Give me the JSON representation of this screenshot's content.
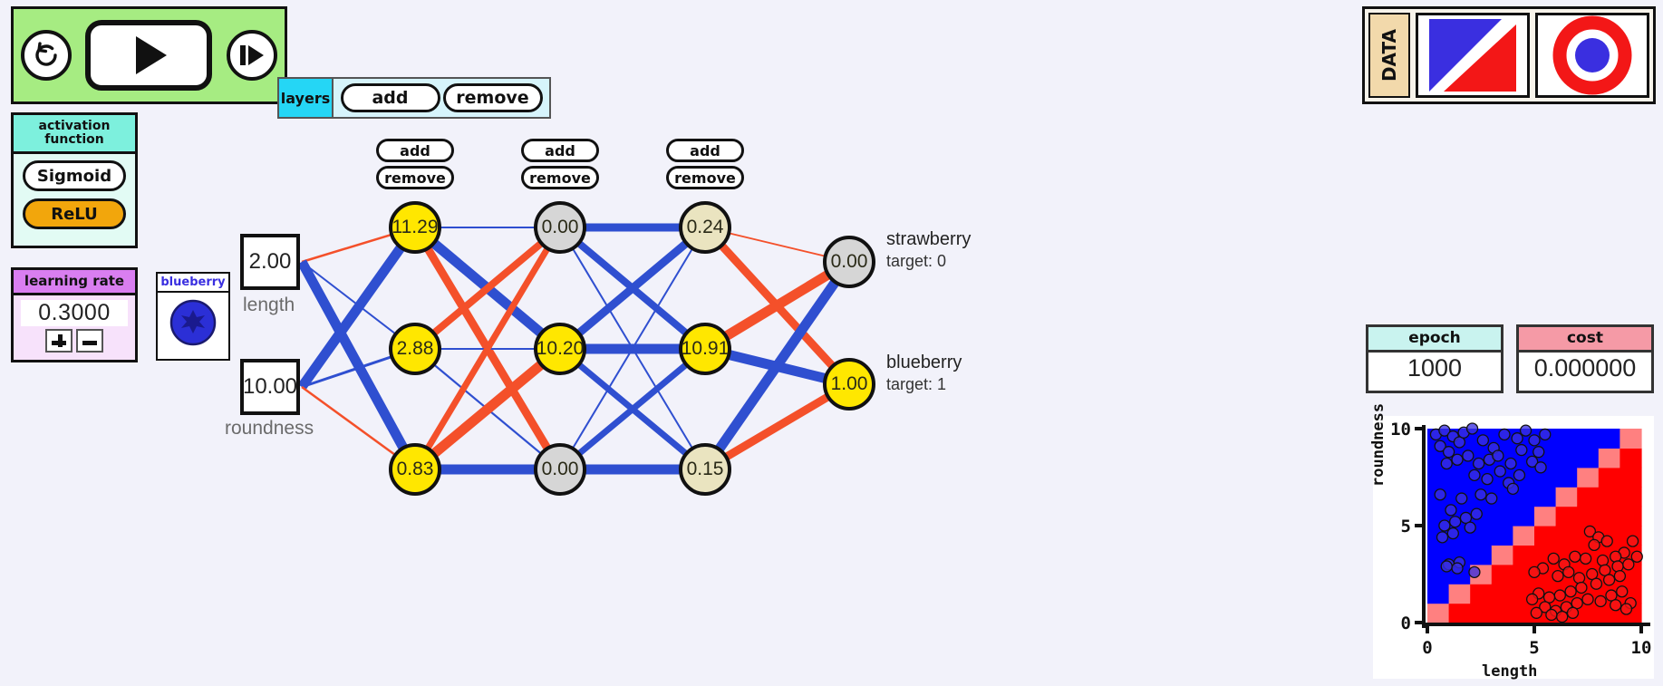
{
  "transport": {
    "reset_label": "reset-icon",
    "play_label": "play-icon",
    "step_label": "step-icon"
  },
  "activation": {
    "title": "activation function",
    "options": [
      {
        "label": "Sigmoid",
        "selected": false
      },
      {
        "label": "ReLU",
        "selected": true
      }
    ]
  },
  "learning_rate": {
    "title": "learning rate",
    "value": "0.3000",
    "increase_label": "+",
    "decrease_label": "−"
  },
  "layers": {
    "tag": "layers",
    "add_label": "add",
    "remove_label": "remove"
  },
  "neuron_controls": {
    "add_label": "add",
    "remove_label": "remove"
  },
  "sample": {
    "caption": "blueberry"
  },
  "inputs": [
    {
      "value": "2.00",
      "label": "length"
    },
    {
      "value": "10.00",
      "label": "roundness"
    }
  ],
  "hidden_layers": [
    {
      "nodes": [
        {
          "value": "11.29",
          "state": "hot"
        },
        {
          "value": "2.88",
          "state": "hot"
        },
        {
          "value": "0.83",
          "state": "hot"
        }
      ]
    },
    {
      "nodes": [
        {
          "value": "0.00",
          "state": "zero"
        },
        {
          "value": "10.20",
          "state": "hot"
        },
        {
          "value": "0.00",
          "state": "zero"
        }
      ]
    },
    {
      "nodes": [
        {
          "value": "0.24",
          "state": "warm"
        },
        {
          "value": "10.91",
          "state": "hot"
        },
        {
          "value": "0.15",
          "state": "warm"
        }
      ]
    }
  ],
  "outputs": [
    {
      "value": "0.00",
      "name": "strawberry",
      "target": "target: 0",
      "state": "out"
    },
    {
      "value": "1.00",
      "name": "blueberry",
      "target": "target: 1",
      "state": "out on"
    }
  ],
  "data_panel": {
    "tag": "DATA",
    "datasets": [
      "diagonal-split-dataset",
      "circular-dataset"
    ]
  },
  "stats": {
    "epoch_label": "epoch",
    "epoch_value": "1000",
    "cost_label": "cost",
    "cost_value": "0.000000"
  },
  "colors": {
    "positive_weight": "#2f4fd0",
    "negative_weight": "#f4502a",
    "class_a": "#3a2fe0",
    "class_b": "#f31717",
    "active_node": "#ffe700",
    "inactive_node": "#d6d6d6"
  },
  "chart_data": {
    "type": "scatter",
    "title": "",
    "xlabel": "length",
    "ylabel": "roundness",
    "xlim": [
      0,
      10
    ],
    "ylim": [
      0,
      10
    ],
    "xticks": [
      "0",
      "5",
      "10"
    ],
    "yticks": [
      "0",
      "5",
      "10"
    ],
    "grid": false,
    "legend": "none",
    "series": [
      {
        "name": "blueberry",
        "color": "#3a2fe0",
        "points": [
          [
            0.4,
            9.7
          ],
          [
            0.8,
            9.9
          ],
          [
            1.2,
            9.6
          ],
          [
            1.5,
            9.3
          ],
          [
            0.6,
            9.1
          ],
          [
            1.0,
            8.8
          ],
          [
            1.7,
            9.8
          ],
          [
            2.1,
            10.0
          ],
          [
            2.6,
            9.4
          ],
          [
            3.1,
            9.0
          ],
          [
            2.9,
            8.4
          ],
          [
            3.6,
            9.7
          ],
          [
            4.2,
            9.5
          ],
          [
            4.6,
            9.9
          ],
          [
            5.0,
            9.4
          ],
          [
            5.5,
            9.7
          ],
          [
            5.2,
            8.8
          ],
          [
            4.4,
            8.9
          ],
          [
            3.9,
            8.2
          ],
          [
            3.3,
            8.6
          ],
          [
            2.4,
            8.2
          ],
          [
            1.9,
            8.6
          ],
          [
            1.4,
            8.4
          ],
          [
            0.9,
            8.2
          ],
          [
            2.2,
            7.6
          ],
          [
            2.8,
            7.4
          ],
          [
            3.4,
            7.8
          ],
          [
            3.8,
            7.2
          ],
          [
            4.3,
            7.6
          ],
          [
            4.9,
            8.3
          ],
          [
            5.3,
            8.0
          ],
          [
            4.0,
            6.9
          ],
          [
            3.0,
            6.4
          ],
          [
            2.5,
            6.6
          ],
          [
            1.6,
            6.4
          ],
          [
            1.1,
            5.8
          ],
          [
            1.3,
            5.2
          ],
          [
            0.8,
            5.0
          ],
          [
            1.8,
            5.4
          ],
          [
            2.3,
            5.6
          ],
          [
            2.0,
            4.9
          ],
          [
            1.2,
            4.6
          ],
          [
            0.7,
            4.4
          ],
          [
            1.5,
            3.1
          ],
          [
            1.0,
            3.0
          ],
          [
            0.9,
            2.9
          ],
          [
            2.2,
            2.6
          ],
          [
            1.4,
            2.8
          ],
          [
            0.6,
            6.6
          ]
        ]
      },
      {
        "name": "strawberry",
        "color": "#f31717",
        "points": [
          [
            7.6,
            4.7
          ],
          [
            8.0,
            4.4
          ],
          [
            7.8,
            4.0
          ],
          [
            8.4,
            4.2
          ],
          [
            9.6,
            4.2
          ],
          [
            9.2,
            3.6
          ],
          [
            8.8,
            3.4
          ],
          [
            8.2,
            3.2
          ],
          [
            7.4,
            3.3
          ],
          [
            6.9,
            3.4
          ],
          [
            6.4,
            3.0
          ],
          [
            5.9,
            3.3
          ],
          [
            5.4,
            2.8
          ],
          [
            5.0,
            2.6
          ],
          [
            6.1,
            2.4
          ],
          [
            6.6,
            2.6
          ],
          [
            7.1,
            2.3
          ],
          [
            7.7,
            2.5
          ],
          [
            8.3,
            2.7
          ],
          [
            8.9,
            2.9
          ],
          [
            9.4,
            3.0
          ],
          [
            9.8,
            3.4
          ],
          [
            9.0,
            2.4
          ],
          [
            8.5,
            2.2
          ],
          [
            7.9,
            2.0
          ],
          [
            7.2,
            1.8
          ],
          [
            6.7,
            1.6
          ],
          [
            6.2,
            1.4
          ],
          [
            5.7,
            1.3
          ],
          [
            5.2,
            1.5
          ],
          [
            4.9,
            1.2
          ],
          [
            5.5,
            0.8
          ],
          [
            6.0,
            0.6
          ],
          [
            6.5,
            0.8
          ],
          [
            7.0,
            1.0
          ],
          [
            7.5,
            1.2
          ],
          [
            8.1,
            1.1
          ],
          [
            8.6,
            1.4
          ],
          [
            9.1,
            1.6
          ],
          [
            9.5,
            1.0
          ],
          [
            9.3,
            0.7
          ],
          [
            5.8,
            0.4
          ],
          [
            6.3,
            0.3
          ],
          [
            6.8,
            0.5
          ],
          [
            5.1,
            0.5
          ],
          [
            8.8,
            0.9
          ]
        ]
      }
    ],
    "decision_regions": {
      "description": "blue above diagonal, red below; soft boundary band",
      "boundary": "roundness = length",
      "region_a_color": "#0000ff",
      "region_b_color": "#ff0000"
    }
  }
}
